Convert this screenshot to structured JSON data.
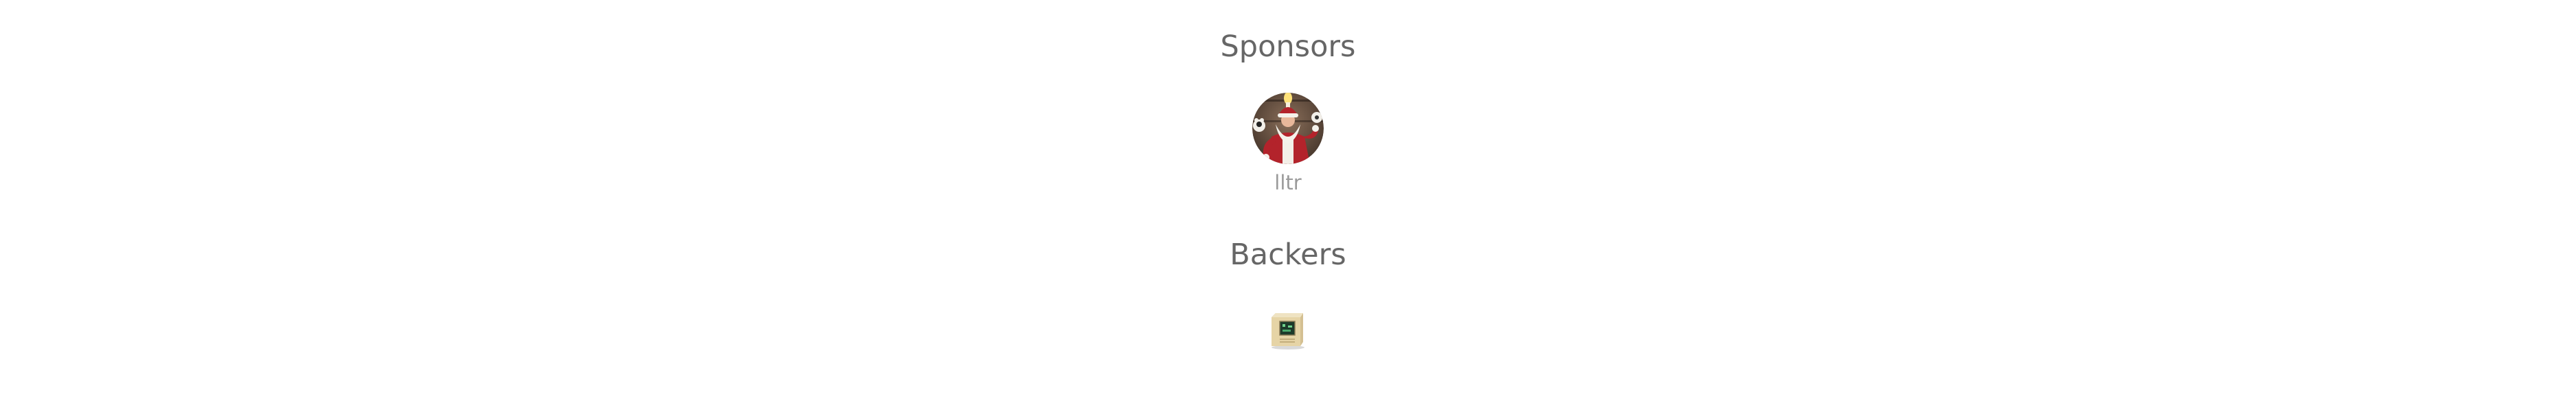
{
  "sections": {
    "sponsors": {
      "title": "Sponsors",
      "items": [
        {
          "name": "lltr",
          "avatar_icon": "santa-claus-avatar"
        }
      ]
    },
    "backers": {
      "title": "Backers",
      "items": [
        {
          "avatar_icon": "computer-box-avatar"
        }
      ]
    }
  },
  "colors": {
    "heading": "#666666",
    "sponsor_name": "#9a9a9a",
    "background": "#ffffff"
  }
}
